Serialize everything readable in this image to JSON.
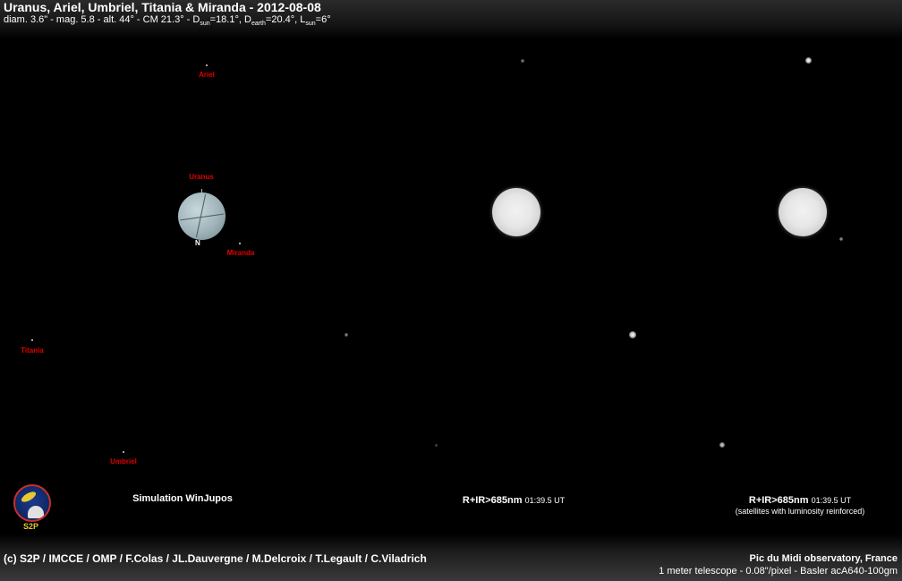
{
  "header": {
    "title": "Uranus, Ariel, Umbriel, Titania & Miranda - 2012-08-08",
    "subtitle_parts": {
      "a": "diam. 3.6\" - mag. 5.8 - alt. 44° - CM 21.3° - D",
      "a_sub": "sun",
      "b": "=18.1°, D",
      "b_sub": "earth",
      "c": "=20.4°, L",
      "c_sub": "sun",
      "d": "=6°"
    }
  },
  "simulation": {
    "planet_label": "Uranus",
    "north_label": "N",
    "moons": {
      "ariel": "Ariel",
      "miranda": "Miranda",
      "titania": "Titania",
      "umbriel": "Umbriel"
    },
    "caption": "Simulation WinJupos"
  },
  "images": [
    {
      "caption": "R+IR>685nm",
      "time": "01:39.5 UT",
      "note": ""
    },
    {
      "caption": "R+IR>685nm",
      "time": "01:39.5 UT",
      "note": "(satellites with luminosity reinforced)"
    }
  ],
  "logo": {
    "text": "S2P",
    "icon": "s2p-observatory-logo"
  },
  "footer": {
    "credits": "(c) S2P / IMCCE / OMP / F.Colas / JL.Dauvergne / M.Delcroix / T.Legault / C.Viladrich",
    "observatory": "Pic du Midi observatory, France",
    "telescope": "1 meter telescope - 0.08\"/pixel - Basler acA640-100gm"
  },
  "colors": {
    "label_red": "#e00000",
    "background": "#000000"
  }
}
